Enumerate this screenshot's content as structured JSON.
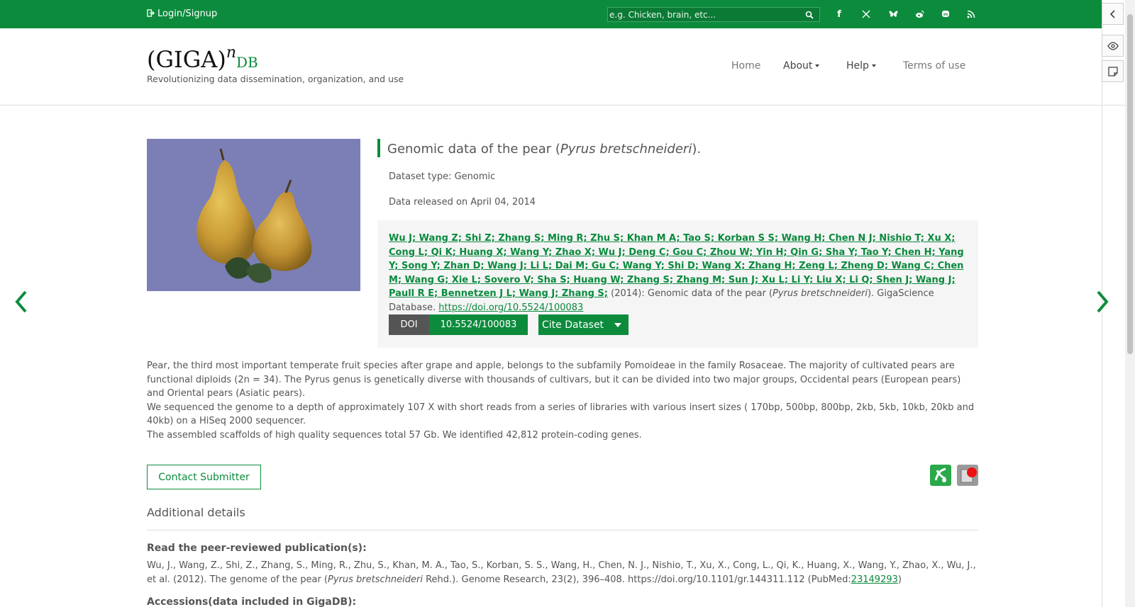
{
  "topbar": {
    "login_label": "Login/Signup",
    "search_placeholder": "e.g. Chicken, brain, etc...",
    "social_icons": [
      "facebook-icon",
      "x-icon",
      "bluesky-icon",
      "weibo-icon",
      "mastodon-icon",
      "rss-icon"
    ]
  },
  "header": {
    "logo_text": "(GIGA)",
    "logo_sup": "n",
    "logo_db": "DB",
    "tagline": "Revolutionizing data dissemination, organization, and use",
    "nav": [
      {
        "label": "Home"
      },
      {
        "label": "About"
      },
      {
        "label": "Help"
      },
      {
        "label": "Terms of use"
      }
    ]
  },
  "dataset": {
    "title_prefix": "Genomic data of the pear (",
    "title_species": "Pyrus bretschneideri",
    "title_suffix": ").",
    "type": "Dataset type:  Genomic",
    "released": "Data released on April 04, 2014",
    "authors": "Wu J; Wang Z; Shi Z; Zhang S; Ming R; Zhu S; Khan M A; Tao S; Korban S S; Wang H; Chen N J; Nishio T; Xu X; Cong L; Qi K; Huang X; Wang Y; Zhao X; Wu J; Deng C; Gou C; Zhou W; Yin H; Qin G; Sha Y; Tao Y; Chen H; Yang Y; Song Y; Zhan D; Wang J; Li L; Dai M; Gu C; Wang Y; Shi D; Wang X; Zhang H; Zeng L; Zheng D; Wang C; Chen M; Wang G; Xie L; Sovero V; Sha S; Huang W; Zhang S; Zhang M; Sun J; Xu L; Li Y; Liu X; Li Q; Shen J; Wang J; Paull R E; Bennetzen J L; Wang J; Zhang S;",
    "cite_year": " (2014): Genomic data of the pear (",
    "cite_species": "Pyrus bretschneideri",
    "cite_tail": "). GigaScience Database. ",
    "cite_link": "https://doi.org/10.5524/100083",
    "doi_label": "DOI",
    "doi_value": "10.5524/100083",
    "cite_button": "Cite Dataset"
  },
  "description": {
    "p1": "Pear, the third most important temperate fruit species after grape and apple, belongs to the subfamily Pomoideae in the family Rosaceae. The majority of cultivated pears are functional diploids (2n = 34). The Pyrus genus is genetically diverse with thousands of cultivars, but it can be divided into two major groups, Occidental pears (European pears) and Oriental pears (Asiatic pears).",
    "p2": "We sequenced the genome to a depth of approximately 107 X with short reads from a series of libraries with various insert sizes ( 170bp, 500bp, 800bp, 2kb, 5kb, 10kb, 20kb and 40kb) on a HiSeq 2000 sequencer.",
    "p3": "The assembled scaffolds of high quality sequences total 57 Gb. We identified 42,812 protein-coding genes."
  },
  "contact_button": "Contact Submitter",
  "additional": {
    "title": "Additional details",
    "pub_heading": "Read the peer-reviewed publication(s):",
    "pub_text_a": "Wu, J., Wang, Z., Shi, Z., Zhang, S., Ming, R., Zhu, S., Khan, M. A., Tao, S., Korban, S. S., Wang, H., Chen, N. J., Nishio, T., Xu, X., Cong, L., Qi, K., Huang, X., Wang, Y., Zhao, X., Wu, J., et al. (2012). The genome of the pear (",
    "pub_species": "Pyrus bretschneideri",
    "pub_text_b": " Rehd.). Genome Research, 23(2), 396–408. https://doi.org/10.1101/gr.144311.112 (PubMed:",
    "pubmed_id": "23149293",
    "pub_text_c": ")",
    "accessions_heading": "Accessions(data included in GigaDB):"
  },
  "colors": {
    "brand_green": "#0d8b3d",
    "doi_gray": "#555555"
  }
}
